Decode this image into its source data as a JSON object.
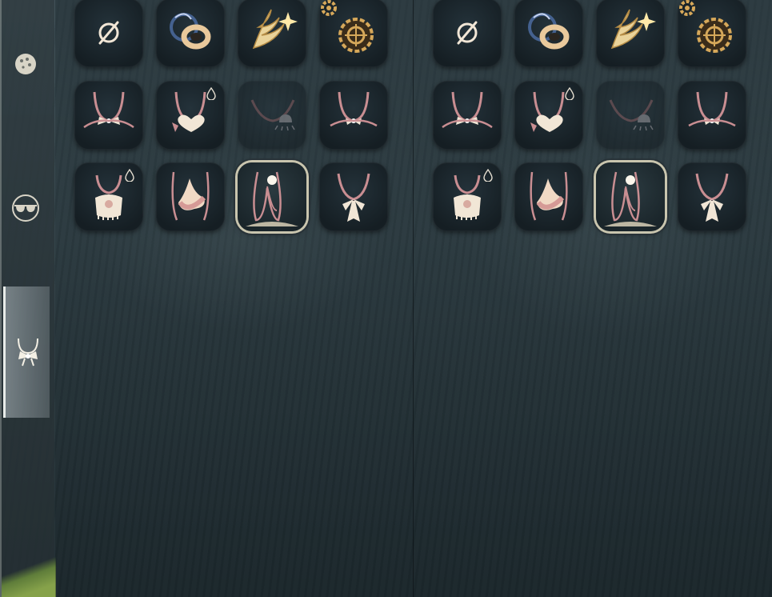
{
  "sidebar": {
    "items": [
      {
        "id": "face",
        "icon": "face-paint-icon",
        "active": false
      },
      {
        "id": "glasses",
        "icon": "glasses-icon",
        "active": false
      },
      {
        "id": "neckwear",
        "icon": "neckwear-icon",
        "active": true
      }
    ]
  },
  "panels": [
    {
      "id": "left"
    },
    {
      "id": "right"
    }
  ],
  "grid": [
    {
      "icon": "none-symbol-icon",
      "dyeable": false,
      "special": false,
      "dim": false,
      "selected": false
    },
    {
      "icon": "headphones-icon",
      "dyeable": false,
      "special": false,
      "dim": false,
      "selected": false
    },
    {
      "icon": "wings-icon",
      "dyeable": false,
      "special": false,
      "dim": false,
      "selected": false
    },
    {
      "icon": "gear-medallion-icon",
      "dyeable": false,
      "special": true,
      "dim": false,
      "selected": false
    },
    {
      "icon": "bow-necklace-icon",
      "dyeable": false,
      "special": false,
      "dim": false,
      "selected": false
    },
    {
      "icon": "heart-necklace-icon",
      "dyeable": true,
      "special": false,
      "dim": false,
      "selected": false
    },
    {
      "icon": "bell-collar-icon",
      "dyeable": false,
      "special": false,
      "dim": true,
      "selected": false
    },
    {
      "icon": "ribbon-necklace-icon",
      "dyeable": false,
      "special": false,
      "dim": false,
      "selected": false
    },
    {
      "icon": "scarf-necklace-icon",
      "dyeable": true,
      "special": false,
      "dim": false,
      "selected": false
    },
    {
      "icon": "tooth-pendant-icon",
      "dyeable": false,
      "special": false,
      "dim": false,
      "selected": false
    },
    {
      "icon": "pearl-pendant-icon",
      "dyeable": false,
      "special": false,
      "dim": false,
      "selected": true
    },
    {
      "icon": "sailor-tie-icon",
      "dyeable": false,
      "special": false,
      "dim": false,
      "selected": false
    }
  ],
  "colors": {
    "cord": "#c98e92",
    "cream": "#f1e6d6",
    "gold": "#d6a85a",
    "selected_ring": "#c9c5ae"
  }
}
